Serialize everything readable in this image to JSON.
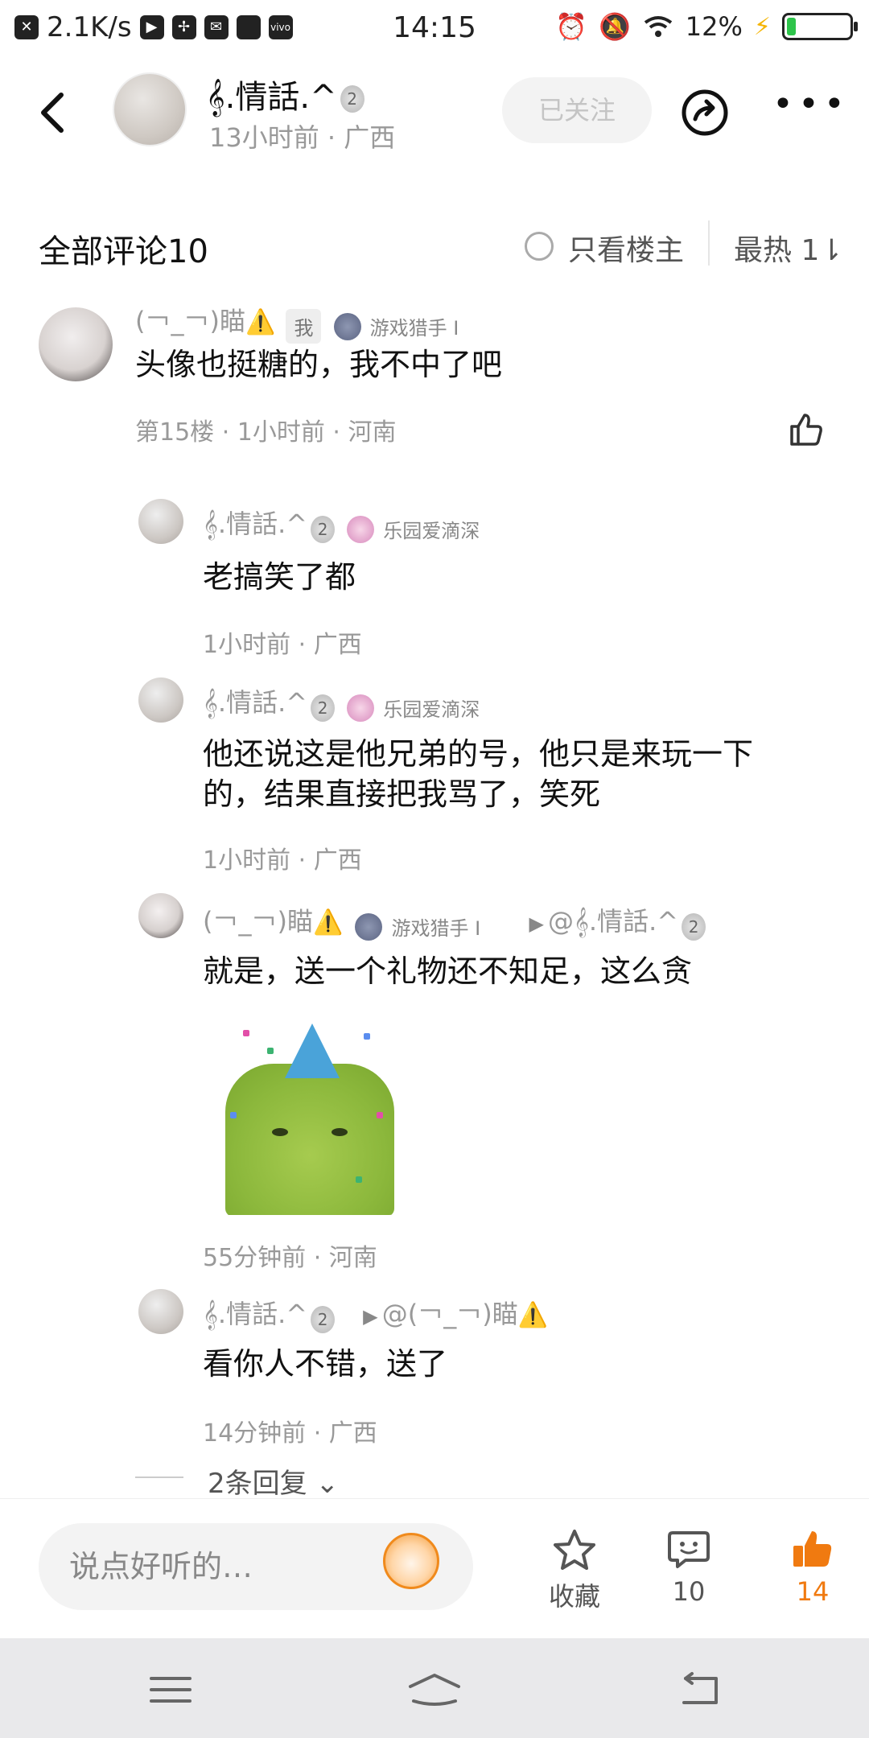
{
  "status_bar": {
    "speed": "2.1K/s",
    "time": "14:15",
    "battery": "12%",
    "icons": [
      "close-box-icon",
      "play-icon",
      "fan-icon",
      "mail-icon",
      "square-icon",
      "vivo-icon",
      "alarm-icon",
      "mute-bell-icon",
      "wifi-icon",
      "charging-icon"
    ]
  },
  "header": {
    "author_name": "𝄞.情話.^",
    "author_meta": "13小时前 · 广西",
    "follow_label": "已关注"
  },
  "comments_header": {
    "title": "全部评论10",
    "owner_only": "只看楼主",
    "sort": "最热 1⇂"
  },
  "comment": {
    "author": "(￢_￢)瞄",
    "self_tag": "我",
    "badge": "游戏猎手 I",
    "text": "头像也挺糖的，我不中了吧",
    "meta": "第15楼 · 1小时前 · 河南"
  },
  "replies": [
    {
      "author": "𝄞.情話.^",
      "badge": "乐园爱滴深",
      "text": "老搞笑了都",
      "meta": "1小时前 · 广西"
    },
    {
      "author": "𝄞.情話.^",
      "badge": "乐园爱滴深",
      "text_line1": "他还说这是他兄弟的号，他只是来玩一下",
      "text_line2": "的，结果直接把我骂了，笑死",
      "meta": "1小时前 · 广西"
    },
    {
      "author": "(￢_￢)瞄",
      "badge": "游戏猎手 I",
      "reply_to": "@𝄞.情話.^",
      "text": "就是，送一个礼物还不知足，这么贪",
      "meta": "55分钟前 · 河南"
    },
    {
      "author": "𝄞.情話.^",
      "reply_to": "@(￢_￢)瞄",
      "text": "看你人不错，送了",
      "meta": "14分钟前 · 广西"
    }
  ],
  "more_replies": "2条回复 ⌄",
  "bottom_bar": {
    "input_placeholder": "说点好听的…",
    "collect_label": "收藏",
    "comment_count": "10",
    "like_count": "14"
  },
  "colors": {
    "accent_orange": "#f07a10",
    "gray_text": "#999999",
    "warning_yellow": "#f0b400"
  }
}
